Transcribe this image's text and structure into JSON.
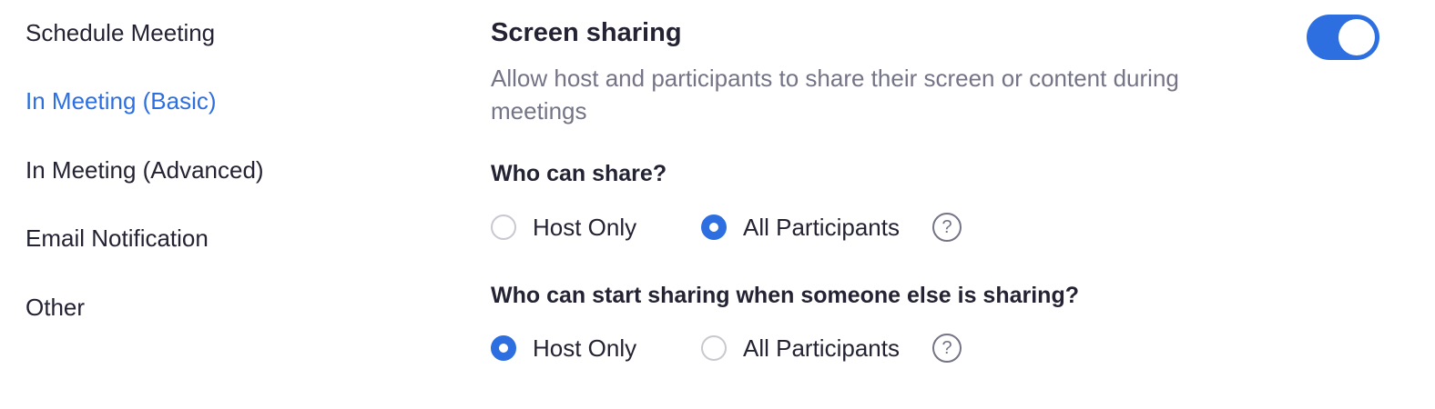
{
  "sidebar": {
    "items": [
      {
        "label": "Schedule Meeting",
        "active": false
      },
      {
        "label": "In Meeting (Basic)",
        "active": true
      },
      {
        "label": "In Meeting (Advanced)",
        "active": false
      },
      {
        "label": "Email Notification",
        "active": false
      },
      {
        "label": "Other",
        "active": false
      }
    ]
  },
  "setting": {
    "title": "Screen sharing",
    "description": "Allow host and participants to share their screen or content during meetings",
    "enabled": true
  },
  "who_can_share": {
    "question": "Who can share?",
    "options": [
      {
        "label": "Host Only",
        "selected": false
      },
      {
        "label": "All Participants",
        "selected": true
      }
    ],
    "help_icon": "?"
  },
  "who_can_start": {
    "question": "Who can start sharing when someone else is sharing?",
    "options": [
      {
        "label": "Host Only",
        "selected": true
      },
      {
        "label": "All Participants",
        "selected": false
      }
    ],
    "help_icon": "?"
  },
  "colors": {
    "accent": "#2d6fe0",
    "text": "#232333",
    "muted": "#747487",
    "radio_border": "#c8c8d0"
  },
  "icons": {
    "help": "question-circle-icon",
    "toggle": "toggle-switch"
  }
}
